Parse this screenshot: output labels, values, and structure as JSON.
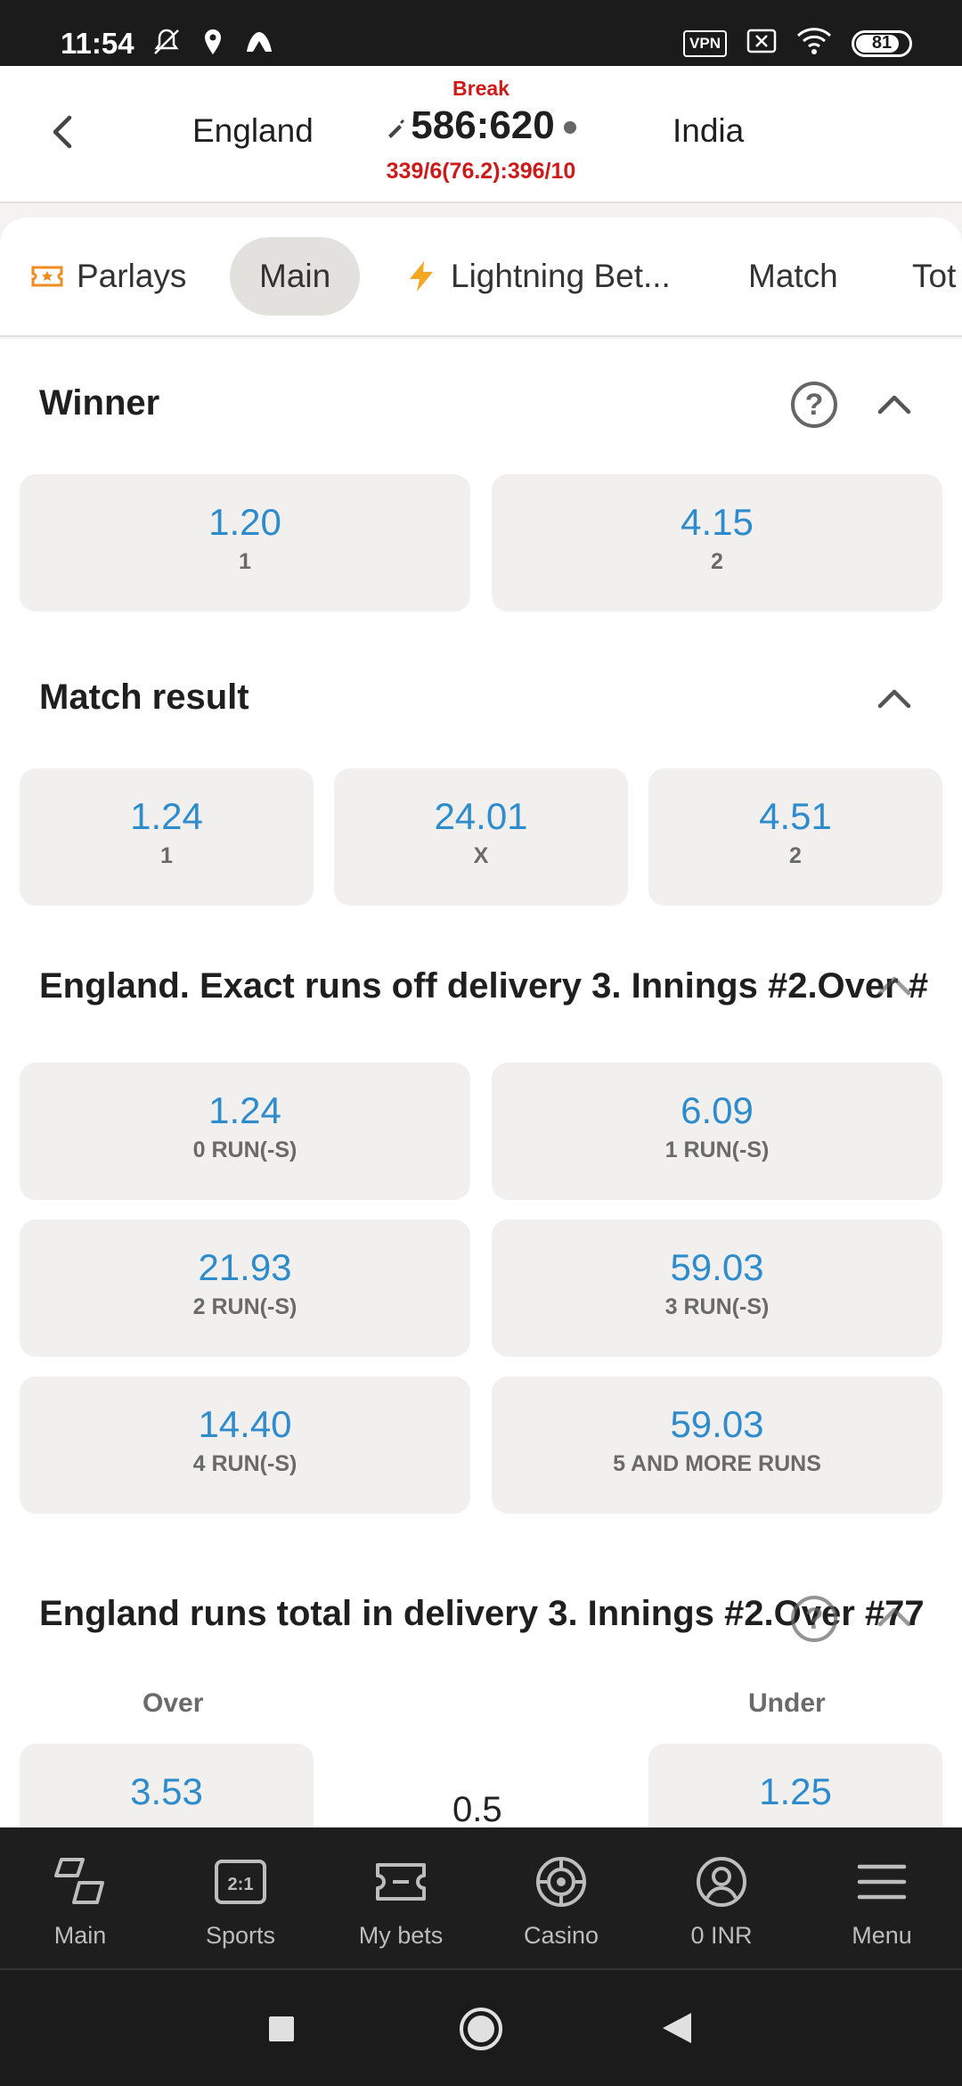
{
  "status": {
    "time": "11:54",
    "vpn": "VPN",
    "battery": "81"
  },
  "header": {
    "back_icon": "chevron-left-icon",
    "team1": "England",
    "team2": "India",
    "status_label": "Break",
    "score": "586:620",
    "subscore": "339/6(76.2):396/10"
  },
  "tabs": [
    {
      "label": "Parlays",
      "icon": "ticket-icon"
    },
    {
      "label": "Main",
      "active": true
    },
    {
      "label": "Lightning Bet...",
      "icon": "lightning-icon"
    },
    {
      "label": "Match"
    },
    {
      "label": "Tot"
    }
  ],
  "markets": {
    "winner": {
      "title": "Winner",
      "odds": [
        {
          "value": "1.20",
          "label": "1"
        },
        {
          "value": "4.15",
          "label": "2"
        }
      ]
    },
    "match_result": {
      "title": "Match result",
      "odds": [
        {
          "value": "1.24",
          "label": "1"
        },
        {
          "value": "24.01",
          "label": "X"
        },
        {
          "value": "4.51",
          "label": "2"
        }
      ]
    },
    "exact_runs": {
      "title": "England. Exact runs off delivery 3. Innings #2.Over #",
      "odds": [
        {
          "value": "1.24",
          "label": "0 RUN(-S)"
        },
        {
          "value": "6.09",
          "label": "1 RUN(-S)"
        },
        {
          "value": "21.93",
          "label": "2 RUN(-S)"
        },
        {
          "value": "59.03",
          "label": "3 RUN(-S)"
        },
        {
          "value": "14.40",
          "label": "4 RUN(-S)"
        },
        {
          "value": "59.03",
          "label": "5 AND MORE RUNS"
        }
      ]
    },
    "runs_total": {
      "title": "England runs total in delivery 3. Innings #2.Over #77",
      "over_label": "Over",
      "under_label": "Under",
      "over_value": "3.53",
      "line": "0.5",
      "under_value": "1.25"
    }
  },
  "bottom_nav": [
    {
      "label": "Main",
      "icon": "main-icon"
    },
    {
      "label": "Sports",
      "icon": "sports-icon"
    },
    {
      "label": "My bets",
      "icon": "ticket-icon"
    },
    {
      "label": "Casino",
      "icon": "casino-chip-icon"
    },
    {
      "label": "0 INR",
      "icon": "account-icon"
    },
    {
      "label": "Menu",
      "icon": "menu-icon"
    }
  ],
  "colors": {
    "odds": "#2f8ccc",
    "alert": "#d01919",
    "tab_active": "#e3e1de",
    "ticket": "#f08c1e"
  }
}
